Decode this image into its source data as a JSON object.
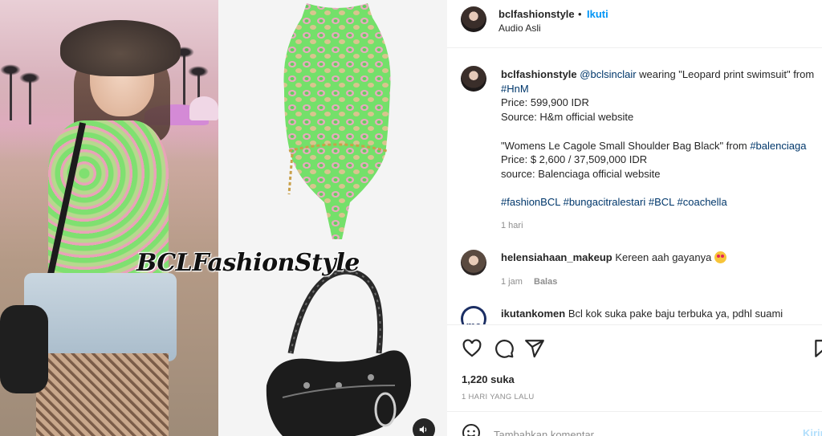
{
  "media": {
    "watermark": "BCLFashionStyle",
    "audio_icon": "speaker-icon"
  },
  "header": {
    "username": "bclfashionstyle",
    "separator": "•",
    "follow_label": "Ikuti",
    "audio_label": "Audio Asli"
  },
  "caption": {
    "username": "bclfashionstyle",
    "mention": "@bclsinclair",
    "line1_text": " wearing \"Leopard print swimsuit\" from",
    "hashtag_hnm": "#HnM",
    "price1": "Price: 599,900 IDR",
    "source1": "Source: H&m official website",
    "item2_text": "\"Womens Le Cagole Small Shoulder Bag Black\" from ",
    "hashtag_balenciaga": "#balenciaga",
    "price2": "Price: $ 2,600 / 37,509,000 IDR",
    "source2": "source: Balenciaga official website",
    "hashtags": [
      "#fashionBCL",
      "#bungacitralestari",
      "#BCL",
      "#coachella"
    ],
    "time": "1 hari"
  },
  "comments": [
    {
      "username": "helensiahaan_makeup",
      "text": "Kereen aah gayanya",
      "emoji": "heart-eyes-emoji",
      "time": "1 jam",
      "reply_label": "Balas"
    },
    {
      "username": "ikutankomen",
      "avatar_text": "me",
      "text": "Bcl kok suka pake baju terbuka ya, pdhl suami"
    }
  ],
  "actions": {
    "like_icon": "heart-icon",
    "comment_icon": "comment-icon",
    "share_icon": "share-icon",
    "save_icon": "bookmark-icon",
    "likes": "1,220 suka",
    "time_ago": "1 HARI YANG LALU"
  },
  "add_comment": {
    "emoji_icon": "smile-icon",
    "placeholder": "Tambahkan komentar...",
    "post_label": "Kirim"
  },
  "colors": {
    "accent": "#0095f6",
    "link": "#00376b",
    "muted": "#8e8e8e"
  }
}
